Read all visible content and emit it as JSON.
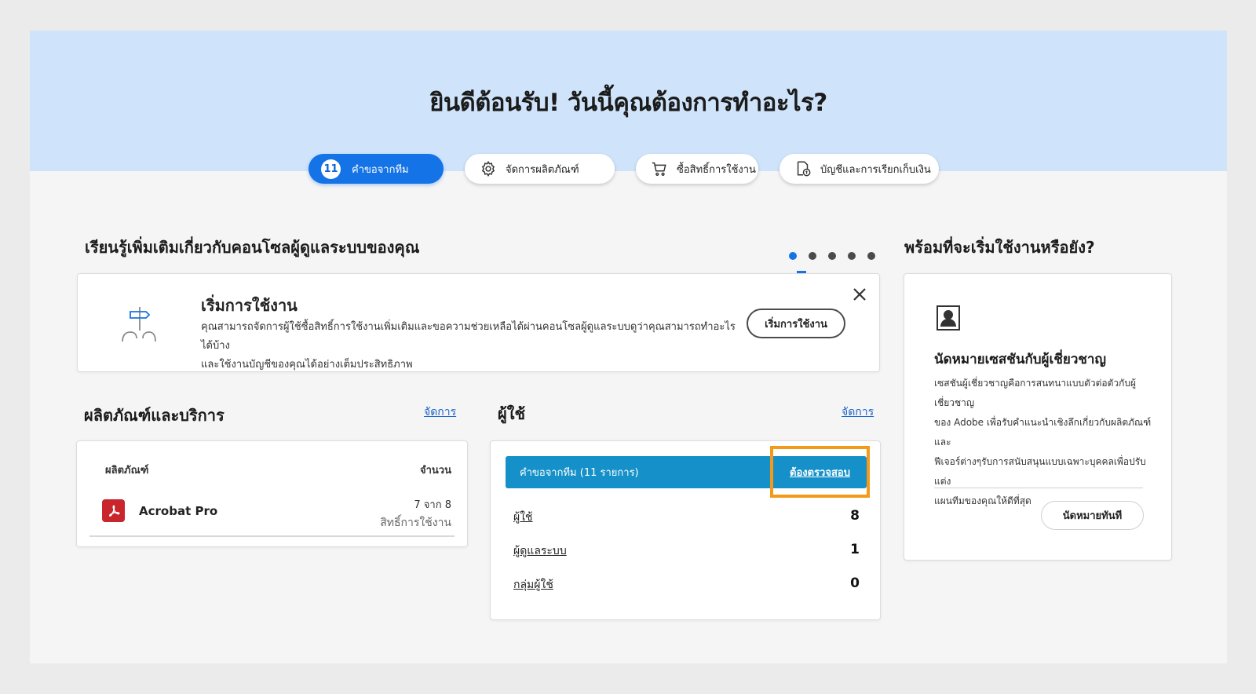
{
  "header": {
    "title": "ยินดีต้อนรับ! วันนี้คุณต้องการทำอะไร?"
  },
  "tabs": [
    {
      "badge": "11",
      "label": "คำขอจากทีม",
      "active": true
    },
    {
      "icon": "gear-icon",
      "label": "จัดการผลิตภัณฑ์"
    },
    {
      "icon": "cart-icon",
      "label": "ซื้อสิทธิ์การใช้งาน"
    },
    {
      "icon": "billing-doc-icon",
      "label": "บัญชีและการเรียกเก็บเงิน"
    }
  ],
  "learn": {
    "title": "เรียนรู้เพิ่มเติมเกี่ยวกับคอนโซลผู้ดูแลระบบของคุณ",
    "carousel": {
      "total": 5,
      "active_index": 0
    },
    "card": {
      "icon": "signpost-icon",
      "title": "เริ่มการใช้งาน",
      "desc_line1": "คุณสามารถจัดการผู้ใช้ซื้อสิทธิ์การใช้งานเพิ่มเติมและขอความช่วยเหลือได้ผ่านคอนโซลผู้ดูแลระบบดูว่าคุณสามารถทำอะไรได้บ้าง",
      "desc_line2": "และใช้งานบัญชีของคุณได้อย่างเต็มประสิทธิภาพ",
      "button": "เริ่มการใช้งาน"
    }
  },
  "ready": {
    "title": "พร้อมที่จะเริ่มใช้งานหรือยัง?",
    "card": {
      "icon": "expert-portrait-icon",
      "title": "นัดหมายเซสชันกับผู้เชี่ยวชาญ",
      "desc_lines": [
        "เซสชันผู้เชี่ยวชาญคือการสนทนาแบบตัวต่อตัวกับผู้เชี่ยวชาญ",
        "ของ Adobe เพื่อรับคำแนะนำเชิงลึกเกี่ยวกับผลิตภัณฑ์และ",
        "ฟีเจอร์ต่างๆรับการสนับสนุนแบบเฉพาะบุคคลเพื่อปรับแต่ง",
        "แผนทีมของคุณให้ดีที่สุด"
      ],
      "button": "นัดหมายทันที"
    }
  },
  "products": {
    "title": "ผลิตภัณฑ์และบริการ",
    "manage_link": "จัดการ",
    "col_product": "ผลิตภัณฑ์",
    "col_count": "จำนวน",
    "items": [
      {
        "name": "Acrobat Pro",
        "icon": "acrobat-icon",
        "count": "7 จาก 8",
        "unit": "สิทธิ์การใช้งาน"
      }
    ]
  },
  "users": {
    "title": "ผู้ใช้",
    "manage_link": "จัดการ",
    "requests_label": "คำขอจากทีม (11 รายการ)",
    "review_link": "ต้องตรวจสอบ",
    "rows": [
      {
        "label": "ผู้ใช้",
        "value": "8"
      },
      {
        "label": "ผู้ดูแลระบบ",
        "value": "1"
      },
      {
        "label": "กลุ่มผู้ใช้",
        "value": "0"
      }
    ]
  },
  "colors": {
    "accent": "#1473e6",
    "hero_bg": "#cfe4fa",
    "requests_bar": "#1690c9",
    "highlight": "#f39a1b",
    "acrobat_red": "#c9252c"
  }
}
